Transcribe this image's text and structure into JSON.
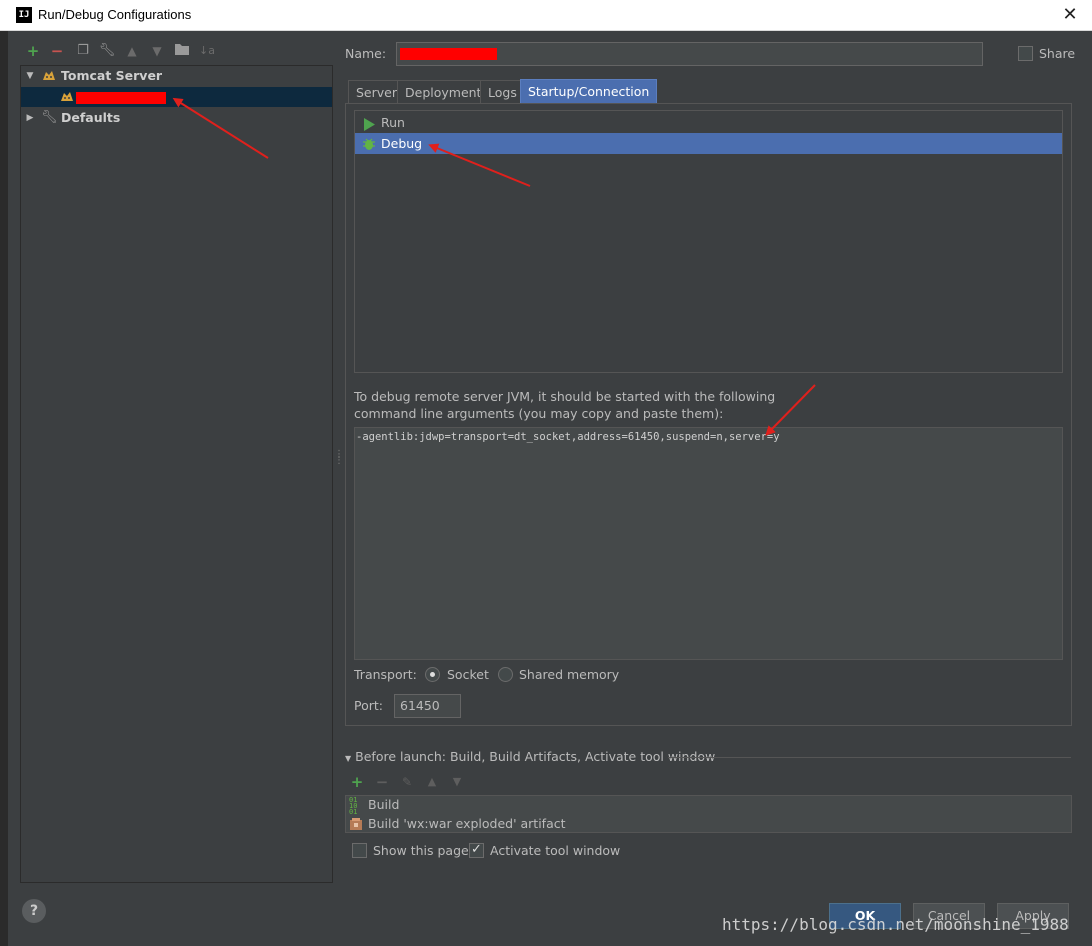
{
  "window": {
    "title": "Run/Debug Configurations",
    "app_icon": "IJ",
    "close_glyph": "✕"
  },
  "colors": {
    "background": "#3c3f41",
    "selection": "#4b6eaf",
    "tree_selection": "#0d293e",
    "redaction": "#ff0000",
    "annotation_arrow": "#e0201c"
  },
  "toolbar": {
    "icons": [
      "add-icon",
      "remove-icon",
      "copy-icon",
      "wrench-icon",
      "arrow-up-icon",
      "arrow-down-icon",
      "folder-icon",
      "sort-icon"
    ]
  },
  "tree": {
    "tomcat_label": "Tomcat Server",
    "defaults_label": "Defaults"
  },
  "form": {
    "name_label": "Name:",
    "share_label": "Share"
  },
  "tabs": [
    {
      "label": "Server"
    },
    {
      "label": "Deployment"
    },
    {
      "label": "Logs"
    },
    {
      "label": "Startup/Connection",
      "active": true
    }
  ],
  "modes": [
    {
      "label": "Run"
    },
    {
      "label": "Debug",
      "selected": true
    }
  ],
  "debug": {
    "hint_line1": "To debug remote server JVM, it should be started with the following",
    "hint_line2": "command line arguments (you may copy and paste them):",
    "args": "-agentlib:jdwp=transport=dt_socket,address=61450,suspend=n,server=y",
    "transport_label": "Transport:",
    "transport_options": [
      "Socket",
      "Shared memory"
    ],
    "transport_selected": "Socket",
    "port_label": "Port:",
    "port_value": "61450"
  },
  "before_launch": {
    "title": "Before launch: Build, Build Artifacts, Activate tool window",
    "items": [
      "Build",
      "Build 'wx:war exploded' artifact"
    ],
    "show_this_page_label": "Show this page",
    "show_this_page_checked": false,
    "activate_tool_window_label": "Activate tool window",
    "activate_tool_window_checked": true
  },
  "buttons": {
    "ok": "OK",
    "cancel": "Cancel",
    "apply": "Apply",
    "help": "?"
  },
  "watermark": "https://blog.csdn.net/moonshine_1988"
}
